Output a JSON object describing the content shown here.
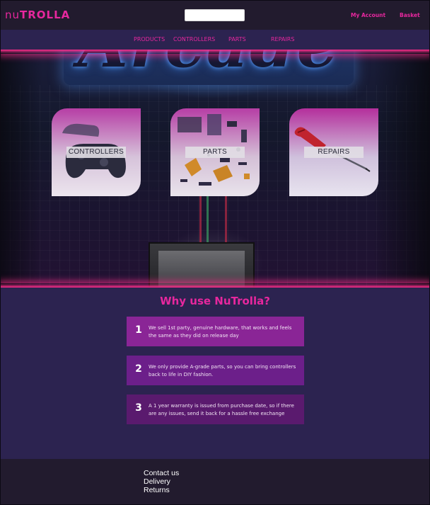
{
  "header": {
    "logo_prefix": "nu",
    "logo_main": "TROLLA",
    "search_value": "",
    "search_placeholder": "",
    "account_label": "My Account",
    "basket_label": "Basket"
  },
  "nav": {
    "items": [
      {
        "label": "PRODUCTS"
      },
      {
        "label": "CONTROLLERS"
      },
      {
        "label": "PARTS"
      },
      {
        "label": "REPAIRS"
      }
    ]
  },
  "hero": {
    "sign_text": "Arcade",
    "cards": [
      {
        "label": "CONTROLLERS",
        "icon": "gamepad-icon"
      },
      {
        "label": "PARTS",
        "icon": "circuit-board-icon"
      },
      {
        "label": "REPAIRS",
        "icon": "screwdriver-icon"
      }
    ]
  },
  "why": {
    "title": "Why use NuTrolla?",
    "reasons": [
      {
        "number": "1",
        "text": "We sell 1st party, genuine hardware, that works and feels the same as they did on release day"
      },
      {
        "number": "2",
        "text": "We only provide A-grade parts, so you can bring controllers back to life in DIY fashion."
      },
      {
        "number": "3",
        "text": "A 1 year warranty is issued from purchase date, so if there are any issues, send it back for a hassle free exchange"
      }
    ]
  },
  "footer": {
    "links": [
      {
        "label": "Contact us"
      },
      {
        "label": "Delivery"
      },
      {
        "label": "Returns"
      }
    ]
  },
  "colors": {
    "accent": "#e7279e",
    "header_bg": "#221b2e",
    "page_bg": "#2c2350",
    "reason_1_bg": "#8a2596",
    "reason_2_bg": "#6c1f8a",
    "reason_3_bg": "#5a1a6e"
  }
}
